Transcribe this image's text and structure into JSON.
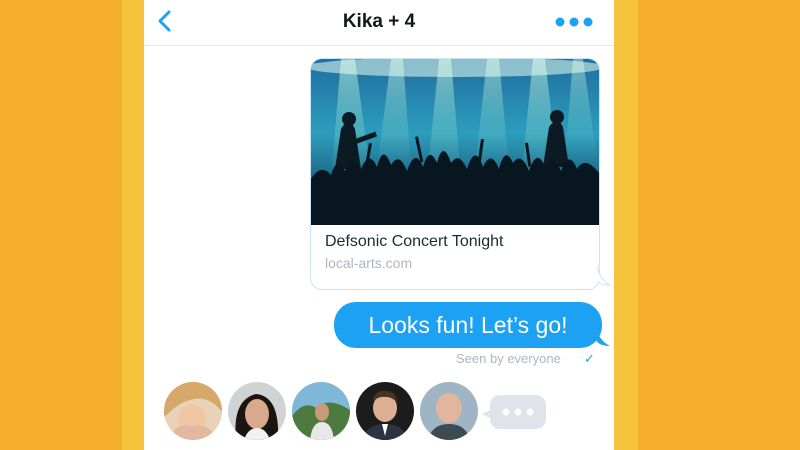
{
  "header": {
    "title": "Kika + 4",
    "back_icon": "chevron-left-icon",
    "more_icon": "more-horizontal-icon"
  },
  "link_card": {
    "title": "Defsonic Concert Tonight",
    "domain": "local-arts.com"
  },
  "message": {
    "text": "Looks fun! Let’s go!",
    "status": "Seen by everyone",
    "status_icon": "checkmark-icon"
  },
  "participants": [
    {
      "avatar": "avatar-woman-blonde"
    },
    {
      "avatar": "avatar-woman-dark-hair"
    },
    {
      "avatar": "avatar-man-outdoor"
    },
    {
      "avatar": "avatar-man-suit"
    },
    {
      "avatar": "avatar-man-bald"
    }
  ],
  "typing_indicator": "typing-dots-icon",
  "colors": {
    "accent": "#1da1f2",
    "background": "#f5ad2e",
    "stripe": "#f6c33c",
    "muted_text": "#aab8c2"
  }
}
